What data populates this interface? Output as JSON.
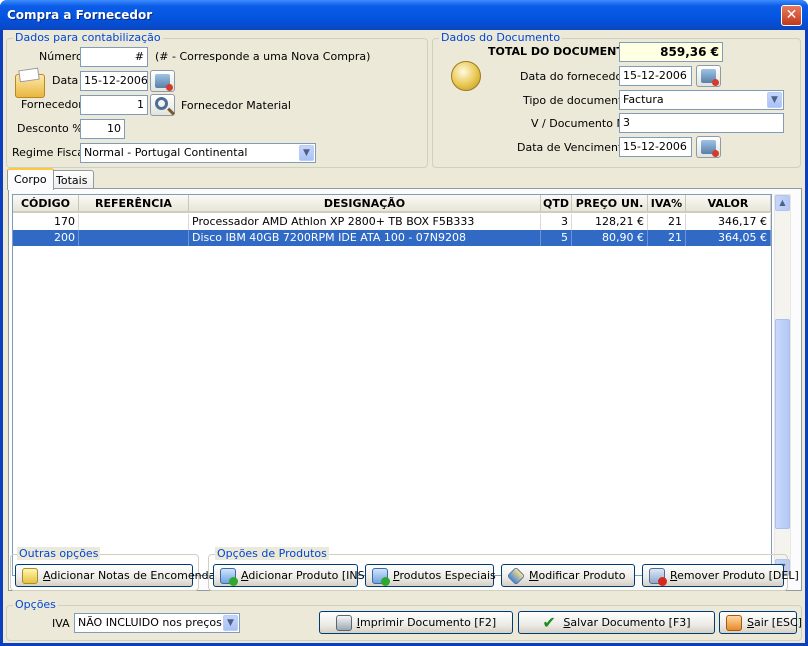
{
  "window": {
    "title": "Compra a Fornecedor",
    "close_label": "✕"
  },
  "contab": {
    "title": "Dados para contabilização",
    "numero_label": "Número",
    "numero_value": "#",
    "numero_hint": "(# - Corresponde a uma Nova Compra)",
    "data_label": "Data",
    "data_value": "15-12-2006",
    "fornecedor_label": "Fornecedor",
    "fornecedor_value": "1",
    "fornecedor_name": "Fornecedor Material",
    "desconto_label": "Desconto %",
    "desconto_value": "10",
    "regime_label": "Regime Fiscal",
    "regime_value": "Normal - Portugal Continental"
  },
  "documento": {
    "title": "Dados do Documento",
    "total_label": "TOTAL DO DOCUMENTO",
    "total_value": "859,36 €",
    "data_fornecedor_label": "Data do fornecedor",
    "data_fornecedor_value": "15-12-2006",
    "tipo_label": "Tipo de documento",
    "tipo_value": "Factura",
    "vdoc_label": "V / Documento Nº",
    "vdoc_value": "3",
    "vencimento_label": "Data de Vencimento",
    "vencimento_value": "15-12-2006"
  },
  "tabs": [
    {
      "label": "Corpo",
      "active": true
    },
    {
      "label": "Totais",
      "active": false
    }
  ],
  "grid": {
    "columns": [
      "CÓDIGO",
      "REFERÊNCIA",
      "DESIGNAÇÃO",
      "QTD",
      "PREÇO UN.",
      "IVA%",
      "VALOR"
    ],
    "rows": [
      {
        "codigo": "170",
        "referencia": "",
        "designacao": "Processador AMD Athlon XP 2800+ TB BOX F5B333",
        "qtd": "3",
        "preco": "128,21 €",
        "iva": "21",
        "valor": "346,17 €",
        "selected": false
      },
      {
        "codigo": "200",
        "referencia": "",
        "designacao": "Disco IBM 40GB 7200RPM IDE ATA 100 - 07N9208",
        "qtd": "5",
        "preco": "80,90 €",
        "iva": "21",
        "valor": "364,05 €",
        "selected": true
      }
    ]
  },
  "outras": {
    "title": "Outras opções",
    "notas_label": "Adicionar Notas de Encomenda",
    "notas_mnemonic": "A",
    "notas_rest": "dicionar Notas de Encomenda"
  },
  "produtos": {
    "title": "Opções de Produtos",
    "adicionar_m": "A",
    "adicionar_rest": "dicionar Produto [INS]",
    "especiais_m": "P",
    "especiais_rest": "rodutos Especiais",
    "modificar_m": "M",
    "modificar_rest": "odificar Produto",
    "remover_m": "R",
    "remover_rest": "emover Produto [DEL]"
  },
  "opcoes": {
    "title": "Opções",
    "iva_label": "IVA",
    "iva_value": "NÃO INCLUIDO nos preços",
    "imprimir_m": "I",
    "imprimir_rest": "mprimir Documento [F2]",
    "salvar_m": "S",
    "salvar_rest": "alvar Documento [F3]",
    "sair_m": "S",
    "sair_rest": "air [ESC]"
  },
  "icons": {
    "folder": "folder-documents-icon",
    "coin": "euro-coin-icon",
    "calendar": "calendar-icon",
    "search": "search-icon",
    "dropdown": "chevron-down-icon"
  },
  "colors": {
    "titlebar": "#0454e0",
    "selection": "#316ac5",
    "group_title": "#0046d5",
    "total_bg": "#ffffe1"
  }
}
